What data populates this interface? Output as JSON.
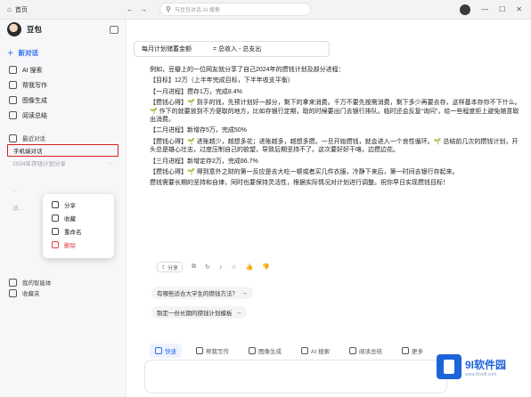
{
  "titlebar": {
    "tab_title": "首页",
    "search_placeholder": "与豆包对话 AI 搜索"
  },
  "sidebar": {
    "brand": "豆包",
    "new_chat": "新对话",
    "items": [
      {
        "label": "AI 搜索",
        "icon": "search-icon"
      },
      {
        "label": "帮我写作",
        "icon": "pen-icon"
      },
      {
        "label": "图像生成",
        "icon": "image-icon"
      },
      {
        "label": "阅读总结",
        "icon": "document-icon"
      }
    ],
    "recent_label": "最近对话",
    "active_chat": "手机端对话",
    "second_chat": "2024年存钱计划分享",
    "faded_chats": [
      "…",
      "请…"
    ],
    "agents_label": "我的智能体",
    "favorites_label": "收藏夹"
  },
  "context_menu": {
    "items": [
      {
        "label": "分享",
        "icon": "share-icon"
      },
      {
        "label": "收藏",
        "icon": "star-icon"
      },
      {
        "label": "重命名",
        "icon": "edit-icon"
      },
      {
        "label": "删除",
        "icon": "trash-icon",
        "danger": true
      }
    ]
  },
  "main": {
    "formula_left": "每月计划储蓄金额",
    "formula_right": "= 总收入 - 总支出",
    "paragraphs": [
      "例如，豆瓣上的一位网友就分享了自己2024年的攒钱计划及部分进程：",
      "【目标】12万（上半年完成目标，下半年收支平衡）",
      "【一月进程】攒存1万，完成8.4%",
      "【攒钱心得】🌱 到手的钱，先预计划好一部分，剩下的拿来消费。千万不要先按需消费，剩下多少再要去存，这样基本存你不下什么。🌱 作下的就要放到不方便取的地方，比如存银行定期，取的时候要出门去银行排队。临时还会反复“询问”，给一些程度拒上避免随意取出消费。",
      "【二月进程】新增存5万，完成50%",
      "【攒钱心得】🌱 进账越少，越想多花；进账越多，越想多攒。一旦开始攒钱，就会进入一个良性循环。🌱 总结前几次的攒钱计划，开头总是雄心壮志，过度压制自己的欲望，导致后期坚持不了。这次要好好干咯，边攒边花。",
      "【三月进程】新增定存2万，完成66.7%",
      "【攒钱心得】🌱 得到意外之财的第一反应是去大吃一顿或者买几件衣服，冷静下来后，第一时间去银行存起来。",
      "攒钱需要长期的坚持和自律，同时也要保持灵活性，根据实际情况对计划进行调整。祝你早日实现攒钱目标！"
    ],
    "action_share": "分享",
    "suggestions": [
      "有哪些适合大学生的攒钱方法？",
      "制定一份长期的攒钱计划模板"
    ],
    "toolbar": [
      {
        "label": "快速",
        "primary": true
      },
      {
        "label": "帮我写作"
      },
      {
        "label": "图像生成"
      },
      {
        "label": "AI 搜索"
      },
      {
        "label": "阅读总结"
      },
      {
        "label": "更多"
      }
    ]
  },
  "watermark": {
    "title": "9I软件园",
    "sub": "www.9rsoft.com"
  }
}
